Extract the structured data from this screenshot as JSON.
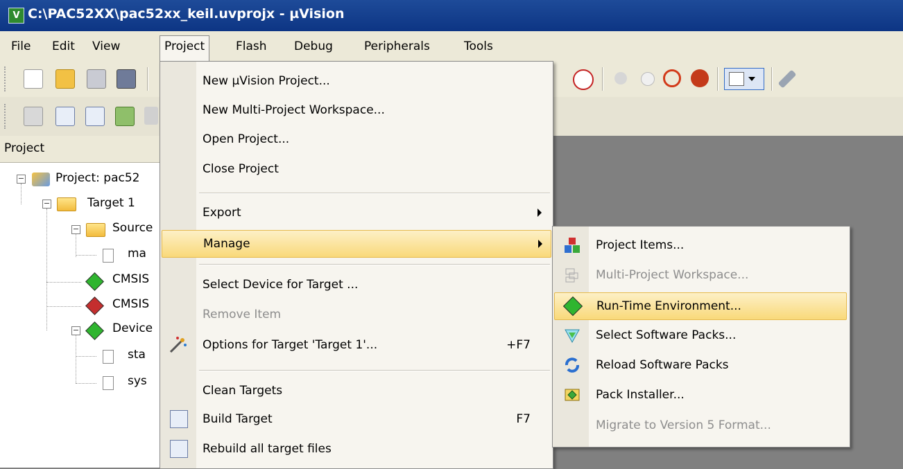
{
  "window": {
    "title": "C:\\PAC52XX\\pac52xx_keil.uvprojx - µVision",
    "app_icon": "uvision-icon"
  },
  "menubar": [
    "File",
    "Edit",
    "View",
    "Project",
    "Flash",
    "Debug",
    "Peripherals",
    "Tools"
  ],
  "project_panel": {
    "header": "Project",
    "tree": [
      {
        "label": "Project: pac52",
        "icon": "project-icon"
      },
      {
        "label": "Target 1",
        "icon": "folder-icon"
      },
      {
        "label": "Source",
        "icon": "folder-icon"
      },
      {
        "label": "ma",
        "icon": "file-icon"
      },
      {
        "label": "CMSIS",
        "icon": "green-diamond-icon"
      },
      {
        "label": "CMSIS",
        "icon": "red-diamond-icon"
      },
      {
        "label": "Device",
        "icon": "green-diamond-icon"
      },
      {
        "label": "sta",
        "icon": "file-icon"
      },
      {
        "label": "sys",
        "icon": "file-icon"
      }
    ]
  },
  "project_menu": {
    "items": [
      {
        "label": "New µVision Project..."
      },
      {
        "label": "New Multi-Project Workspace..."
      },
      {
        "label": "Open Project..."
      },
      {
        "label": "Close Project"
      },
      {
        "label": "Export",
        "submenu": true
      },
      {
        "label": "Manage",
        "submenu": true,
        "highlighted": true
      },
      {
        "label": "Select Device for Target ..."
      },
      {
        "label": "Remove Item",
        "disabled": true
      },
      {
        "label": "Options for Target 'Target 1'...",
        "shortcut": "+F7",
        "icon": "options-wand-icon"
      },
      {
        "label": "Clean Targets"
      },
      {
        "label": "Build Target",
        "shortcut": "F7",
        "icon": "build-icon"
      },
      {
        "label": "Rebuild all target files",
        "icon": "rebuild-icon"
      }
    ]
  },
  "manage_submenu": {
    "items": [
      {
        "label": "Project Items...",
        "icon": "project-items-icon"
      },
      {
        "label": "Multi-Project Workspace...",
        "disabled": true,
        "icon": "multi-project-icon"
      },
      {
        "label": "Run-Time Environment...",
        "highlighted": true,
        "icon": "rte-diamond-icon"
      },
      {
        "label": "Select Software Packs...",
        "icon": "select-packs-icon"
      },
      {
        "label": "Reload Software Packs",
        "icon": "reload-icon"
      },
      {
        "label": "Pack Installer...",
        "icon": "pack-installer-icon"
      },
      {
        "label": "Migrate to Version 5 Format...",
        "disabled": true
      }
    ]
  },
  "colors": {
    "titlebar": "#0d3584",
    "menu_bg": "#f7f5ef",
    "highlight": "#f9d97a",
    "workspace": "#808080"
  }
}
